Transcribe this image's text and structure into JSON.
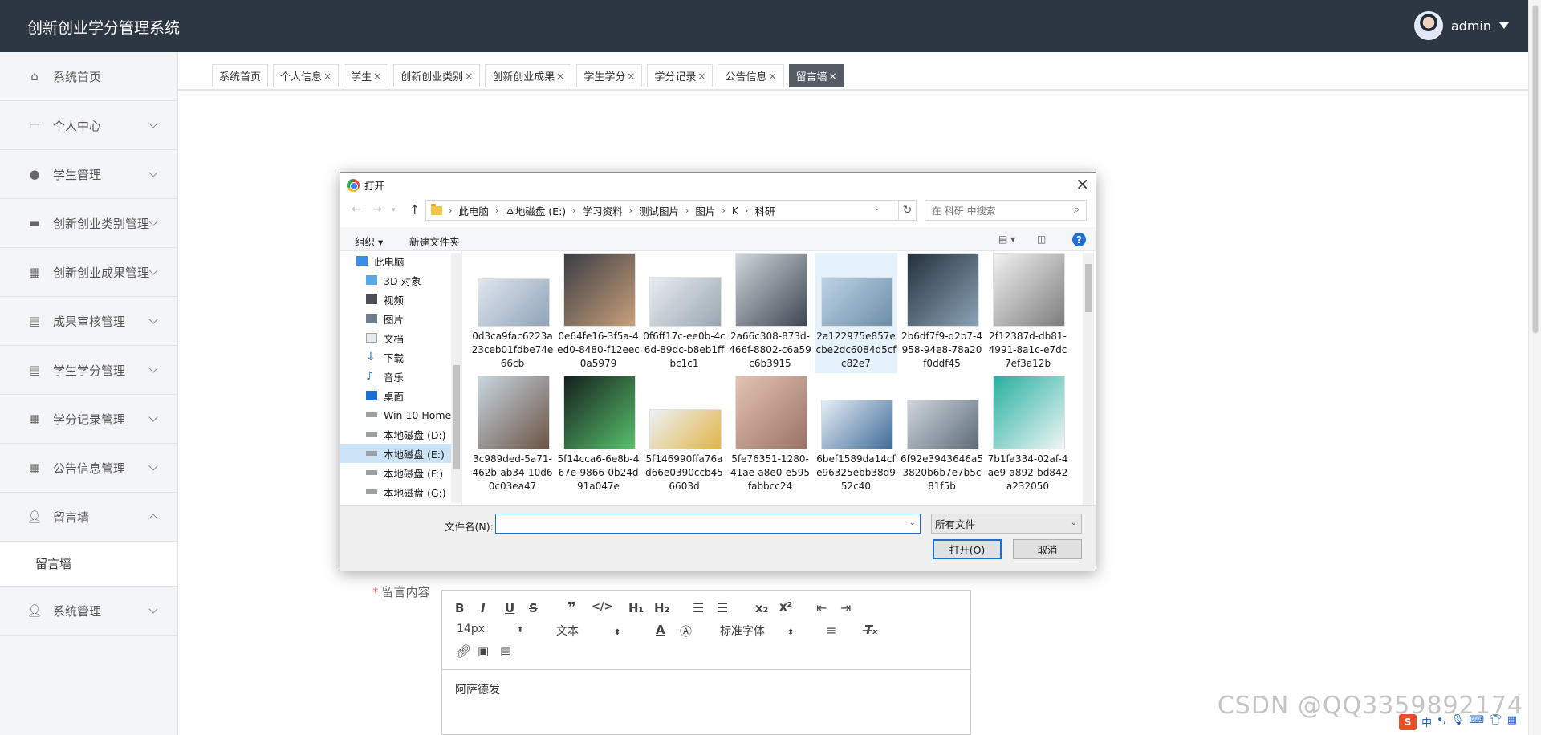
{
  "header": {
    "app_title": "创新创业学分管理系统",
    "username": "admin"
  },
  "sidebar": {
    "items": [
      {
        "label": "系统首页",
        "icon": "home-icon",
        "expandable": false
      },
      {
        "label": "个人中心",
        "icon": "card-icon",
        "expandable": true
      },
      {
        "label": "学生管理",
        "icon": "pin-icon",
        "expandable": true
      },
      {
        "label": "创新创业类别管理",
        "icon": "briefcase-icon",
        "expandable": true
      },
      {
        "label": "创新创业成果管理",
        "icon": "grid-icon",
        "expandable": true
      },
      {
        "label": "成果审核管理",
        "icon": "clipboard-icon",
        "expandable": true
      },
      {
        "label": "学生学分管理",
        "icon": "clipboard-icon",
        "expandable": true
      },
      {
        "label": "学分记录管理",
        "icon": "grid-icon",
        "expandable": true
      },
      {
        "label": "公告信息管理",
        "icon": "grid-icon",
        "expandable": true
      },
      {
        "label": "留言墙",
        "icon": "user-icon",
        "expandable": true,
        "expanded": true
      },
      {
        "label": "系统管理",
        "icon": "user-icon",
        "expandable": true
      }
    ],
    "submenu_label": "留言墙"
  },
  "tabs": [
    {
      "label": "系统首页",
      "closable": false
    },
    {
      "label": "个人信息",
      "closable": true
    },
    {
      "label": "学生",
      "closable": true
    },
    {
      "label": "创新创业类别",
      "closable": true
    },
    {
      "label": "创新创业成果",
      "closable": true
    },
    {
      "label": "学生学分",
      "closable": true
    },
    {
      "label": "学分记录",
      "closable": true
    },
    {
      "label": "公告信息",
      "closable": true
    },
    {
      "label": "留言墙",
      "closable": true,
      "active": true
    }
  ],
  "form": {
    "content_label": "留言内容",
    "required_mark": "*"
  },
  "editor": {
    "font_size": "14px",
    "text_style": "文本",
    "font_family": "标准字体",
    "content": "阿萨德发"
  },
  "dialog": {
    "title": "打开",
    "close": "×",
    "path": [
      "此电脑",
      "本地磁盘 (E:)",
      "学习资料",
      "测试图片",
      "图片",
      "K",
      "科研"
    ],
    "search_placeholder": "在 科研 中搜索",
    "organize_label": "组织 ▾",
    "new_folder_label": "新建文件夹",
    "tree": [
      {
        "label": "此电脑",
        "icon": "computer-icon",
        "indent": 0
      },
      {
        "label": "3D 对象",
        "icon": "cube-icon",
        "indent": 1
      },
      {
        "label": "视频",
        "icon": "video-icon",
        "indent": 1
      },
      {
        "label": "图片",
        "icon": "picture-icon",
        "indent": 1
      },
      {
        "label": "文档",
        "icon": "document-icon",
        "indent": 1
      },
      {
        "label": "下载",
        "icon": "download-icon",
        "indent": 1
      },
      {
        "label": "音乐",
        "icon": "music-icon",
        "indent": 1
      },
      {
        "label": "桌面",
        "icon": "desktop-icon",
        "indent": 1
      },
      {
        "label": "Win 10 Home ›",
        "icon": "drive-icon",
        "indent": 1
      },
      {
        "label": "本地磁盘 (D:)",
        "icon": "drive-icon",
        "indent": 1
      },
      {
        "label": "本地磁盘 (E:)",
        "icon": "drive-icon",
        "indent": 1,
        "selected": true
      },
      {
        "label": "本地磁盘 (F:)",
        "icon": "drive-icon",
        "indent": 1
      },
      {
        "label": "本地磁盘 (G:)",
        "icon": "drive-icon",
        "indent": 1
      }
    ],
    "files": [
      {
        "name": "0d3ca9fac6223a23ceb01fdbe74e66cb",
        "c1": "#dfe6ee",
        "c2": "#8fa3b8"
      },
      {
        "name": "0e64fe16-3f5a-4ed0-8480-f12eec0a5979",
        "c1": "#3a3d44",
        "c2": "#c9a07a"
      },
      {
        "name": "0f6ff17c-ee0b-4c6d-89dc-b8eb1ffbc1c1",
        "c1": "#e9eef2",
        "c2": "#9aa6b0"
      },
      {
        "name": "2a66c308-873d-466f-8802-c6a59c6b3915",
        "c1": "#d0d6dc",
        "c2": "#3e4752"
      },
      {
        "name": "2a122975e857ecbe2dc6084d5cfc82e7",
        "c1": "#bcd3e4",
        "c2": "#6d8ea8",
        "selected": true
      },
      {
        "name": "2b6df7f9-d2b7-4958-94e8-78a20f0ddf45",
        "c1": "#24303b",
        "c2": "#8ca4b7"
      },
      {
        "name": "2f12387d-db81-4991-8a1c-e7dc7ef3a12b",
        "c1": "#f2f2f2",
        "c2": "#7d7d7d"
      },
      {
        "name": "3c989ded-5a71-462b-ab34-10d60c03ea47",
        "c1": "#c7d7e2",
        "c2": "#6b5343"
      },
      {
        "name": "5f14cca6-6e8b-467e-9866-0b24d91a047e",
        "c1": "#14201c",
        "c2": "#58c06b"
      },
      {
        "name": "5f146990ffa76ad66e0390ccb456603d",
        "c1": "#edf2f5",
        "c2": "#e0b54a"
      },
      {
        "name": "5fe76351-1280-41ae-a8e0-e595fabbcc24",
        "c1": "#e4c3b3",
        "c2": "#9a7364"
      },
      {
        "name": "6bef1589da14cfe96325ebb38d952c40",
        "c1": "#e6eef5",
        "c2": "#3f6b98"
      },
      {
        "name": "6f92e3943646a53820b6b7e7b5c81f5b",
        "c1": "#cfd6dc",
        "c2": "#5c6b78"
      },
      {
        "name": "7b1fa334-02af-4ae9-a892-bd842a232050",
        "c1": "#26b0a0",
        "c2": "#f0f6f5"
      }
    ],
    "filename_label": "文件名(N):",
    "filename_value": "",
    "filetype_value": "所有文件",
    "open_button": "打开(O)",
    "cancel_button": "取消"
  },
  "watermark": "CSDN @QQ3359892174",
  "ime": {
    "logo": "S",
    "mode": "中"
  }
}
